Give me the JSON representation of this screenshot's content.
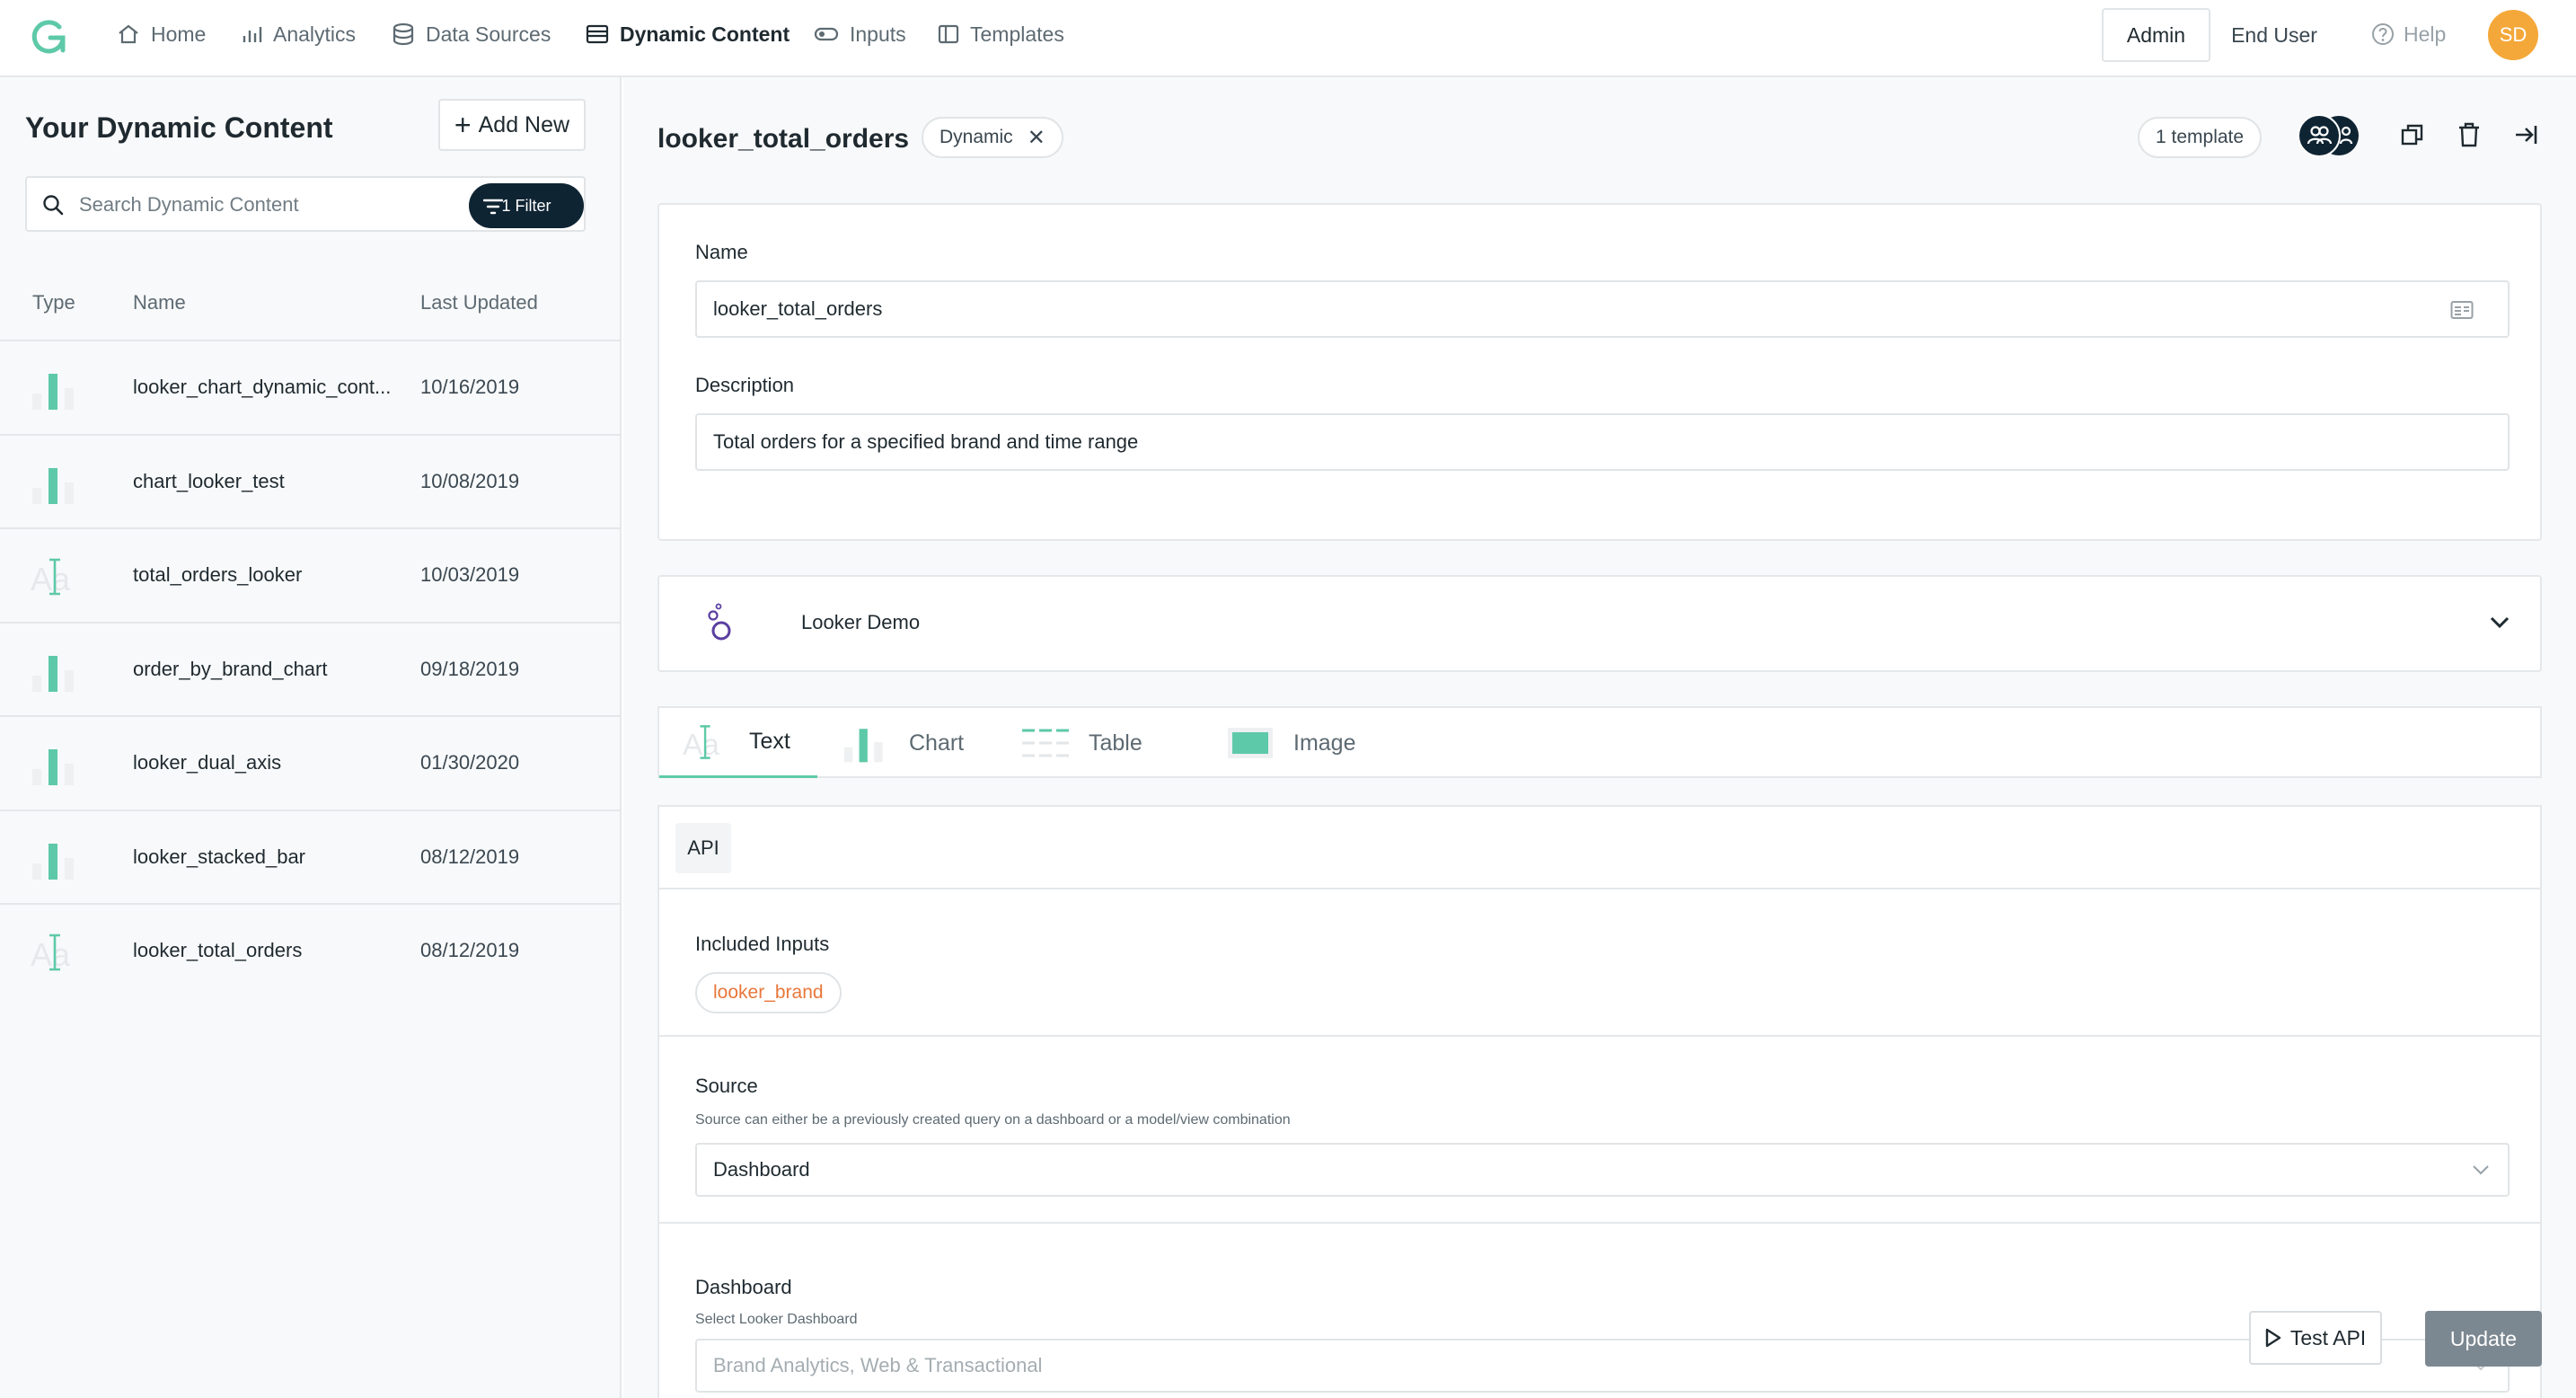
{
  "nav": {
    "items": [
      {
        "label": "Home",
        "icon": "home-icon"
      },
      {
        "label": "Analytics",
        "icon": "analytics-icon"
      },
      {
        "label": "Data Sources",
        "icon": "database-icon"
      },
      {
        "label": "Dynamic Content",
        "icon": "dynamic-content-icon"
      },
      {
        "label": "Inputs",
        "icon": "inputs-icon"
      },
      {
        "label": "Templates",
        "icon": "templates-icon"
      }
    ],
    "active": "Dynamic Content",
    "admin_label": "Admin",
    "end_user_label": "End User",
    "help_label": "Help",
    "avatar_initials": "SD"
  },
  "sidebar": {
    "title": "Your Dynamic Content",
    "add_new_label": "Add New",
    "search_placeholder": "Search Dynamic Content",
    "filter_label": "1 Filter",
    "columns": [
      "Type",
      "Name",
      "Last Updated"
    ],
    "items": [
      {
        "type": "chart",
        "name": "looker_chart_dynamic_cont...",
        "date": "10/16/2019"
      },
      {
        "type": "chart",
        "name": "chart_looker_test",
        "date": "10/08/2019"
      },
      {
        "type": "text",
        "name": "total_orders_looker",
        "date": "10/03/2019"
      },
      {
        "type": "chart",
        "name": "order_by_brand_chart",
        "date": "09/18/2019"
      },
      {
        "type": "chart",
        "name": "looker_dual_axis",
        "date": "01/30/2020"
      },
      {
        "type": "chart",
        "name": "looker_stacked_bar",
        "date": "08/12/2019"
      },
      {
        "type": "text",
        "name": "looker_total_orders",
        "date": "08/12/2019"
      }
    ]
  },
  "main": {
    "title": "looker_total_orders",
    "badge": "Dynamic",
    "template_count": "1 template",
    "name_label": "Name",
    "name_value": "looker_total_orders",
    "description_label": "Description",
    "description_value": "Total orders for a specified brand and time range",
    "data_source": "Looker Demo",
    "tabs": [
      {
        "label": "Text",
        "icon": "text-type-icon"
      },
      {
        "label": "Chart",
        "icon": "chart-type-icon"
      },
      {
        "label": "Table",
        "icon": "table-type-icon"
      },
      {
        "label": "Image",
        "icon": "image-type-icon"
      }
    ],
    "active_tab": "Text",
    "api_tab": "API",
    "included_inputs_label": "Included Inputs",
    "included_input": "looker_brand",
    "source_label": "Source",
    "source_help": "Source can either be a previously created query on a dashboard or a model/view combination",
    "source_value": "Dashboard",
    "dashboard_label": "Dashboard",
    "dashboard_help": "Select Looker Dashboard",
    "dashboard_value": "Brand Analytics, Web & Transactional",
    "test_api_label": "Test API",
    "update_label": "Update"
  },
  "colors": {
    "accent_green": "#5ec9a8",
    "dark_navy": "#0f2433",
    "avatar_orange": "#f4a839",
    "input_orange": "#e8773b",
    "looker_purple": "#5b3fa0"
  }
}
